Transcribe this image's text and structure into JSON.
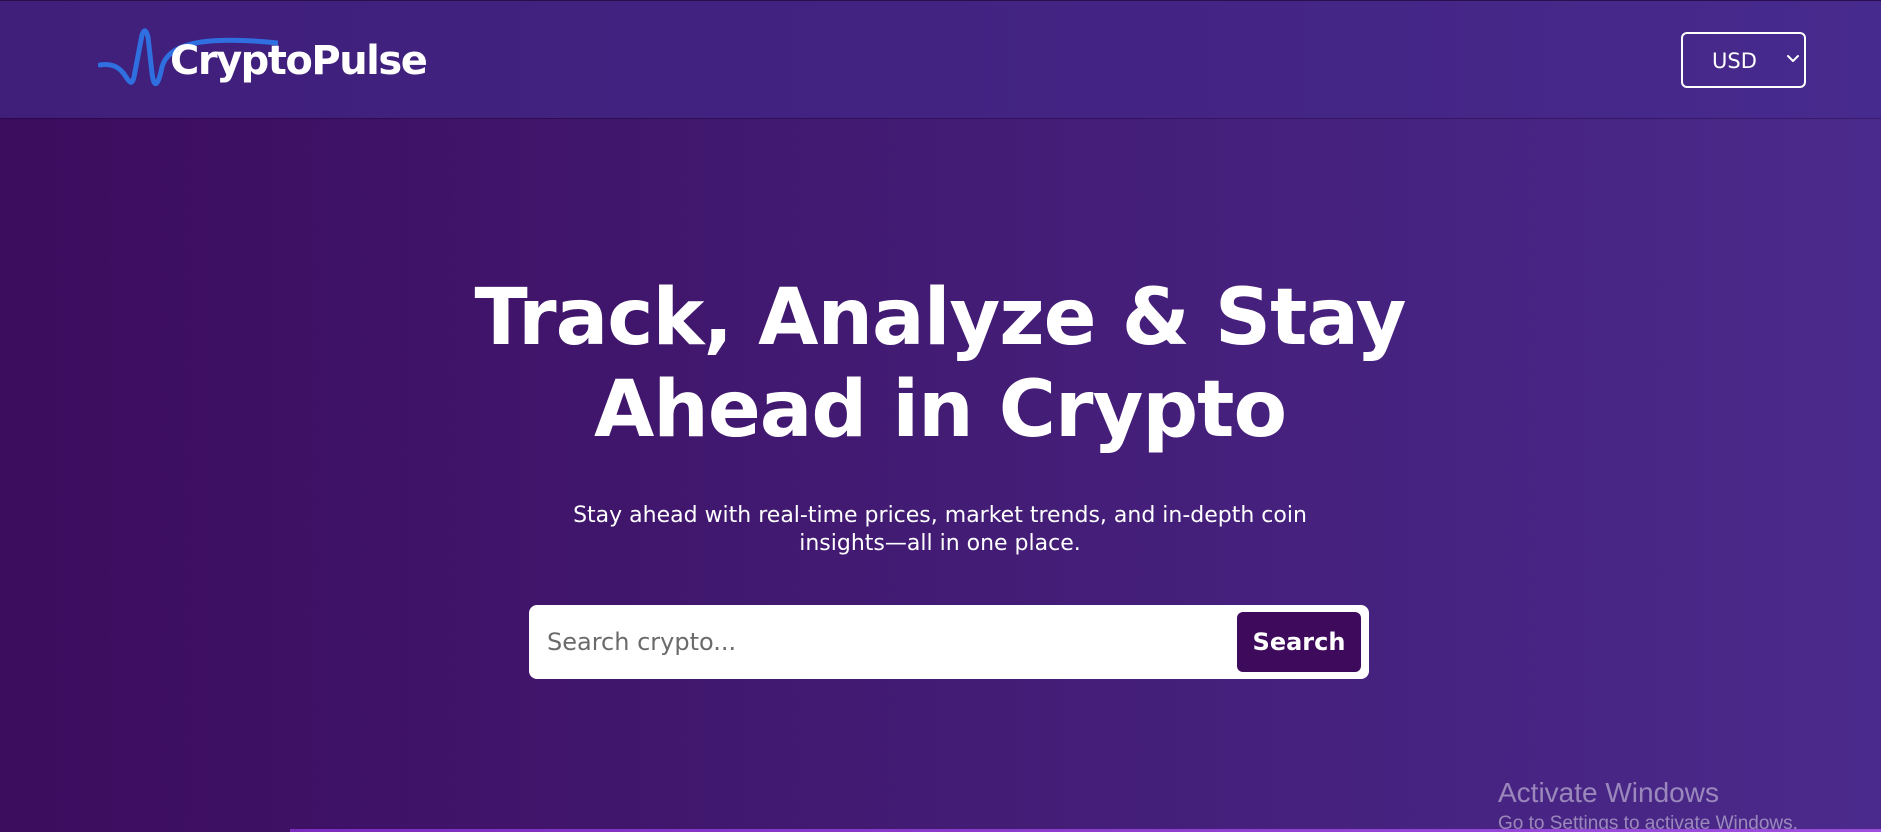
{
  "header": {
    "brand": "CryptoPulse",
    "currency": {
      "selected": "USD"
    }
  },
  "hero": {
    "title_line1": "Track, Analyze & Stay",
    "title_line2": "Ahead in Crypto",
    "subtitle_line1": "Stay ahead with real-time prices, market trends, and in-depth coin",
    "subtitle_line2": "insights—all in one place."
  },
  "search": {
    "placeholder": "Search crypto...",
    "value": "",
    "button_label": "Search"
  },
  "watermark": {
    "title": "Activate Windows",
    "subtitle": "Go to Settings to activate Windows."
  },
  "colors": {
    "background_start": "#3c0c5e",
    "background_end": "#4a2a8c",
    "header": "#432484",
    "button": "#3e0b5c",
    "logo_wave": "#2f6fe0"
  },
  "icons": {
    "logo": "pulse-wave-icon",
    "dropdown": "chevron-down-icon"
  }
}
